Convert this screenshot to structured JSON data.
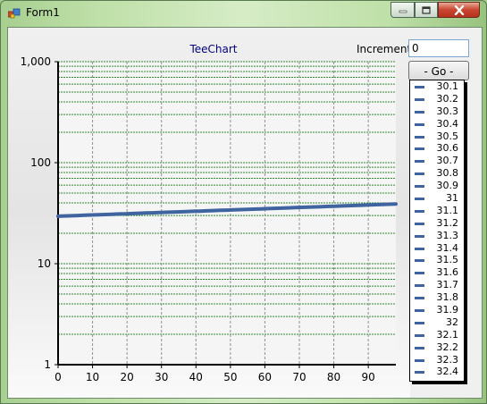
{
  "window": {
    "title": "Form1",
    "icon": "form-app-icon"
  },
  "controls": {
    "increment_label": "Increment",
    "increment_value": "0",
    "go_label": "- Go -"
  },
  "legend": {
    "items": [
      "30.1",
      "30.2",
      "30.3",
      "30.4",
      "30.5",
      "30.6",
      "30.7",
      "30.8",
      "30.9",
      "31",
      "31.1",
      "31.2",
      "31.3",
      "31.4",
      "31.5",
      "31.6",
      "31.7",
      "31.8",
      "31.9",
      "32",
      "32.1",
      "32.2",
      "32.3",
      "32.4"
    ]
  },
  "colors": {
    "series": "#3f64a0",
    "grid_y": "#2e8b2e",
    "grid_x": "#909090",
    "title": "#000080"
  },
  "chart_data": {
    "type": "line",
    "title": "TeeChart",
    "xlabel": "",
    "ylabel": "",
    "x_scale": "linear",
    "y_scale": "log",
    "xlim": [
      0,
      98
    ],
    "ylim": [
      1,
      1000
    ],
    "x_ticks": [
      "0",
      "10",
      "20",
      "30",
      "40",
      "50",
      "60",
      "70",
      "80",
      "90"
    ],
    "y_ticks": [
      "1",
      "10",
      "100",
      "1,000"
    ],
    "grid": true,
    "series": [
      {
        "x_start": 0,
        "x_end": 98,
        "y_start": 29.5,
        "y_end": 39.0
      }
    ]
  }
}
